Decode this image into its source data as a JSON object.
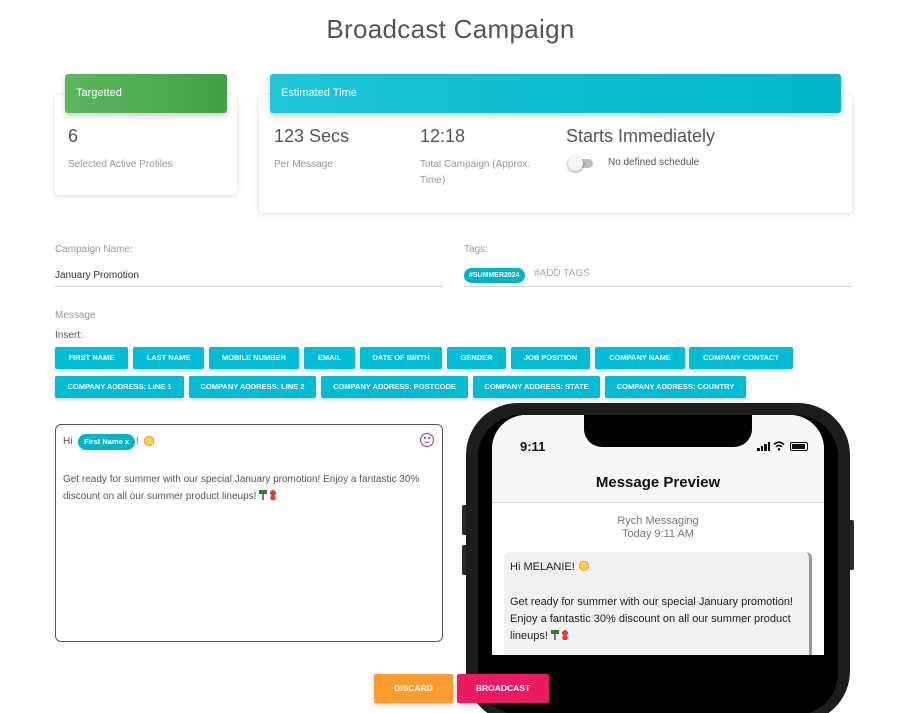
{
  "page": {
    "title": "Broadcast Campaign"
  },
  "targeted": {
    "header": "Targetted",
    "value": "6",
    "label": "Selected Active Profiles"
  },
  "estimated": {
    "header": "Estimated Time",
    "per_message_value": "123 Secs",
    "per_message_label": "Per Message",
    "total_value": "12:18",
    "total_label": "Total Campaign (Approx. Time)",
    "start_value": "Starts Immediately",
    "schedule_label": "No defined schedule",
    "schedule_enabled": false
  },
  "campaign": {
    "label": "Campaign Name:",
    "value": "January Promotion"
  },
  "tags": {
    "label": "Tags:",
    "chips": [
      "#SUMMER2024"
    ],
    "placeholder": "#ADD TAGS"
  },
  "message": {
    "label": "Message",
    "insert_label": "Insert:",
    "insert_buttons_row1": [
      "FIRST NAME",
      "LAST NAME",
      "MOBILE NUMBER",
      "EMAIL",
      "DATE OF BIRTH",
      "GENDER",
      "JOB POSITION",
      "COMPANY NAME",
      "COMPANY CONTACT"
    ],
    "insert_buttons_row2": [
      "COMPANY ADDRESS: LINE 1",
      "COMPANY ADDRESS: LINE 2",
      "COMPANY ADDRESS: POSTCODE",
      "COMPANY ADDRESS: STATE",
      "COMPANY ADDRESS: COUNTRY"
    ],
    "greeting": "Hi",
    "placeholder_chip": "First Name x",
    "exclaim": "!",
    "body": "Get ready for summer with our special January promotion! Enjoy a fantastic 30% discount on all our summer product lineups!",
    "icons": [
      "sun-icon",
      "smiley-icon",
      "palm-tree-icon",
      "bikini-icon"
    ]
  },
  "preview": {
    "status_time": "9:11",
    "title": "Message Preview",
    "sender": "Rych Messaging",
    "timestamp": "Today 9:11 AM",
    "greeting": "Hi MELANIE!",
    "body": "Get ready for summer with our special January promotion! Enjoy a fantastic 30% discount on all our summer product lineups!"
  },
  "actions": {
    "discard": "DISCARD",
    "broadcast": "BROADCAST"
  },
  "colors": {
    "cyan": "#00bcd4",
    "green": "#4caf50",
    "orange": "#ff9c2f",
    "pink": "#ec1a62"
  }
}
